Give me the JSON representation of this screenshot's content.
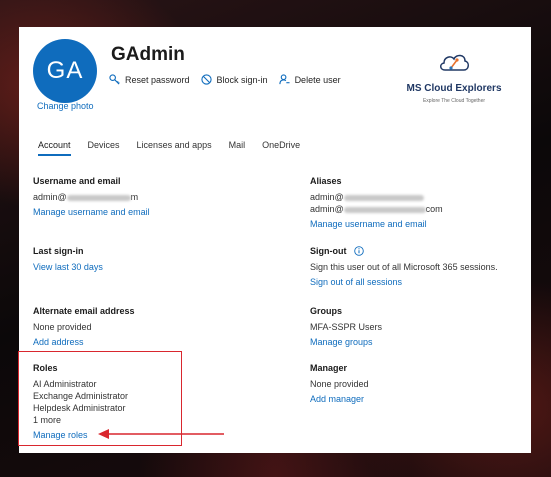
{
  "user": {
    "initials": "GA",
    "change_photo": "Change photo",
    "name": "GAdmin"
  },
  "actions": [
    {
      "label": "Reset password",
      "icon": "key-icon"
    },
    {
      "label": "Block sign-in",
      "icon": "block-icon"
    },
    {
      "label": "Delete user",
      "icon": "person-delete-icon"
    }
  ],
  "brand": {
    "name": "MS Cloud Explorers",
    "tagline": "Explore The Cloud Together"
  },
  "tabs": [
    "Account",
    "Devices",
    "Licenses and apps",
    "Mail",
    "OneDrive"
  ],
  "sections": {
    "username": {
      "heading": "Username and email",
      "value_prefix": "admin@",
      "value_suffix": "m",
      "link": "Manage username and email"
    },
    "aliases": {
      "heading": "Aliases",
      "value1_prefix": "admin@",
      "value2_prefix": "admin@",
      "value2_suffix": "com",
      "link": "Manage username and email"
    },
    "last_signin": {
      "heading": "Last sign-in",
      "link": "View last 30 days"
    },
    "signout": {
      "heading": "Sign-out",
      "text": "Sign this user out of all Microsoft 365 sessions.",
      "link": "Sign out of all sessions"
    },
    "alt_email": {
      "heading": "Alternate email address",
      "value": "None provided",
      "link": "Add address"
    },
    "groups": {
      "heading": "Groups",
      "value": "MFA-SSPR Users",
      "link": "Manage groups"
    },
    "roles": {
      "heading": "Roles",
      "items": [
        "AI Administrator",
        "Exchange Administrator",
        "Helpdesk Administrator",
        "1 more"
      ],
      "link": "Manage roles"
    },
    "manager": {
      "heading": "Manager",
      "value": "None provided",
      "link": "Add manager"
    }
  },
  "colors": {
    "accent": "#0f6cbd",
    "highlight": "#d9272e",
    "brand": "#203864"
  }
}
